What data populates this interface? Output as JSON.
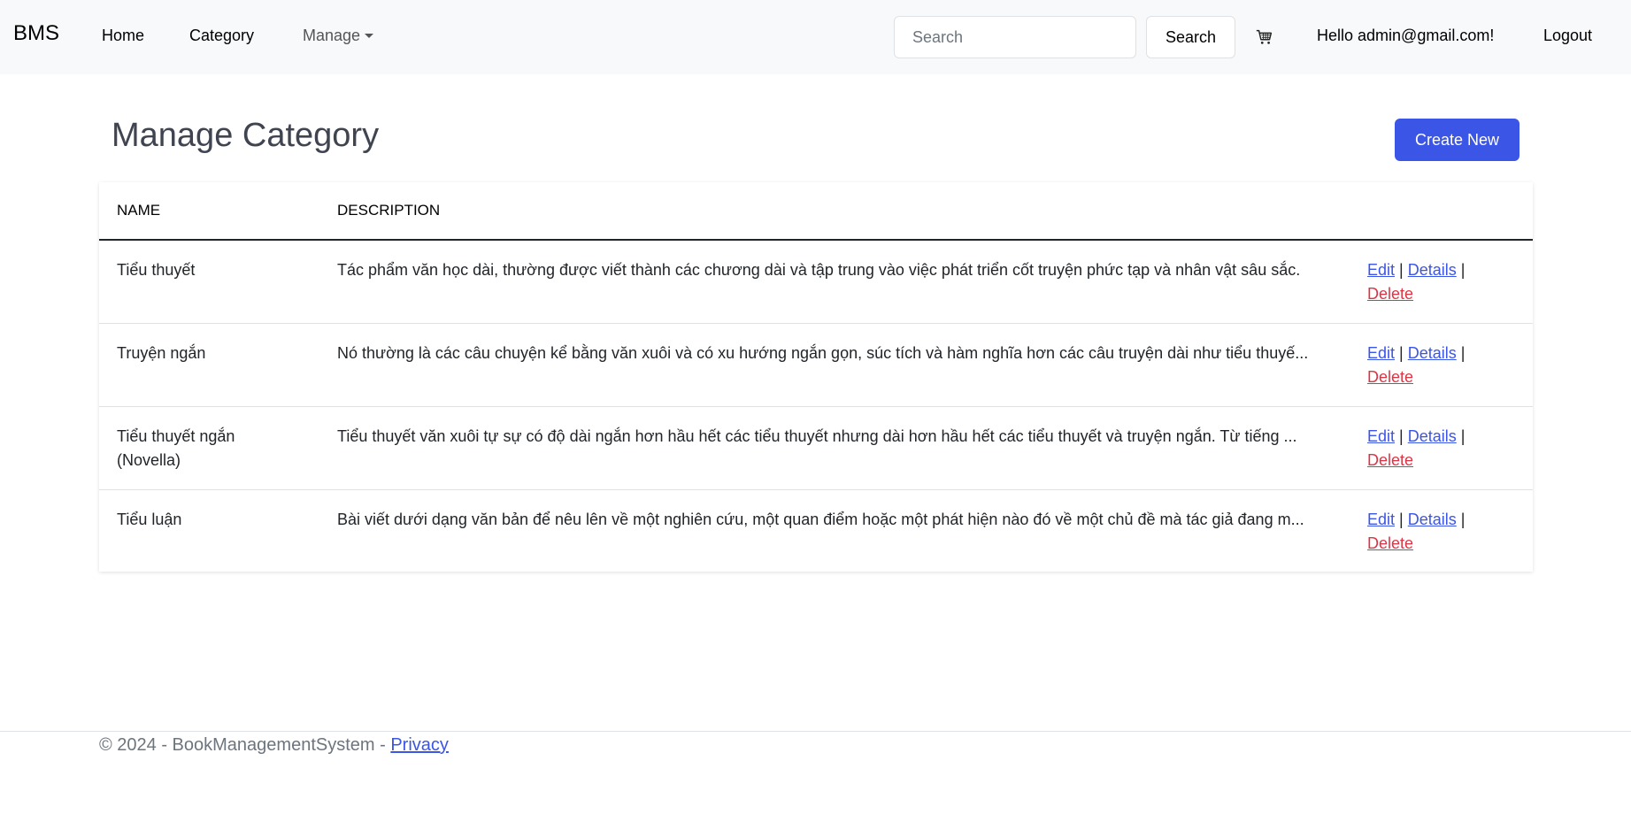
{
  "nav": {
    "brand": "BMS",
    "home": "Home",
    "category": "Category",
    "manage": "Manage",
    "search_placeholder": "Search",
    "search_button": "Search",
    "cart_icon": "cart-icon",
    "greeting": "Hello admin@gmail.com!",
    "logout": "Logout"
  },
  "page": {
    "title": "Manage Category",
    "create_button": "Create New"
  },
  "table": {
    "headers": [
      "NAME",
      "DESCRIPTION"
    ],
    "rows": [
      {
        "name": "Tiểu thuyết",
        "description": "Tác phẩm văn học dài, thường được viết thành các chương dài và tập trung vào việc phát triển cốt truyện phức tạp và nhân vật sâu sắc."
      },
      {
        "name": "Truyện ngắn",
        "description": "Nó thường là các câu chuyện kể bằng văn xuôi và có xu hướng ngắn gọn, súc tích và hàm nghĩa hơn các câu truyện dài như tiểu thuyế..."
      },
      {
        "name": "Tiểu thuyết ngắn (Novella)",
        "description": "Tiểu thuyết văn xuôi tự sự có độ dài ngắn hơn hầu hết các tiểu thuyết nhưng dài hơn hầu hết các tiểu thuyết và truyện ngắn. Từ tiếng ..."
      },
      {
        "name": "Tiểu luận",
        "description": "Bài viết dưới dạng văn bản để nêu lên về một nghiên cứu, một quan điểm hoặc một phát hiện nào đó về một chủ đề mà tác giả đang m..."
      }
    ],
    "actions": {
      "edit": "Edit",
      "details": "Details",
      "delete": "Delete",
      "separator": "|"
    }
  },
  "footer": {
    "copyright": "© 2024 - BookManagementSystem -",
    "privacy": "Privacy"
  },
  "colors": {
    "primary": "#3b55e6",
    "danger": "#dc3545",
    "navbar_bg": "#f8f9fa"
  }
}
